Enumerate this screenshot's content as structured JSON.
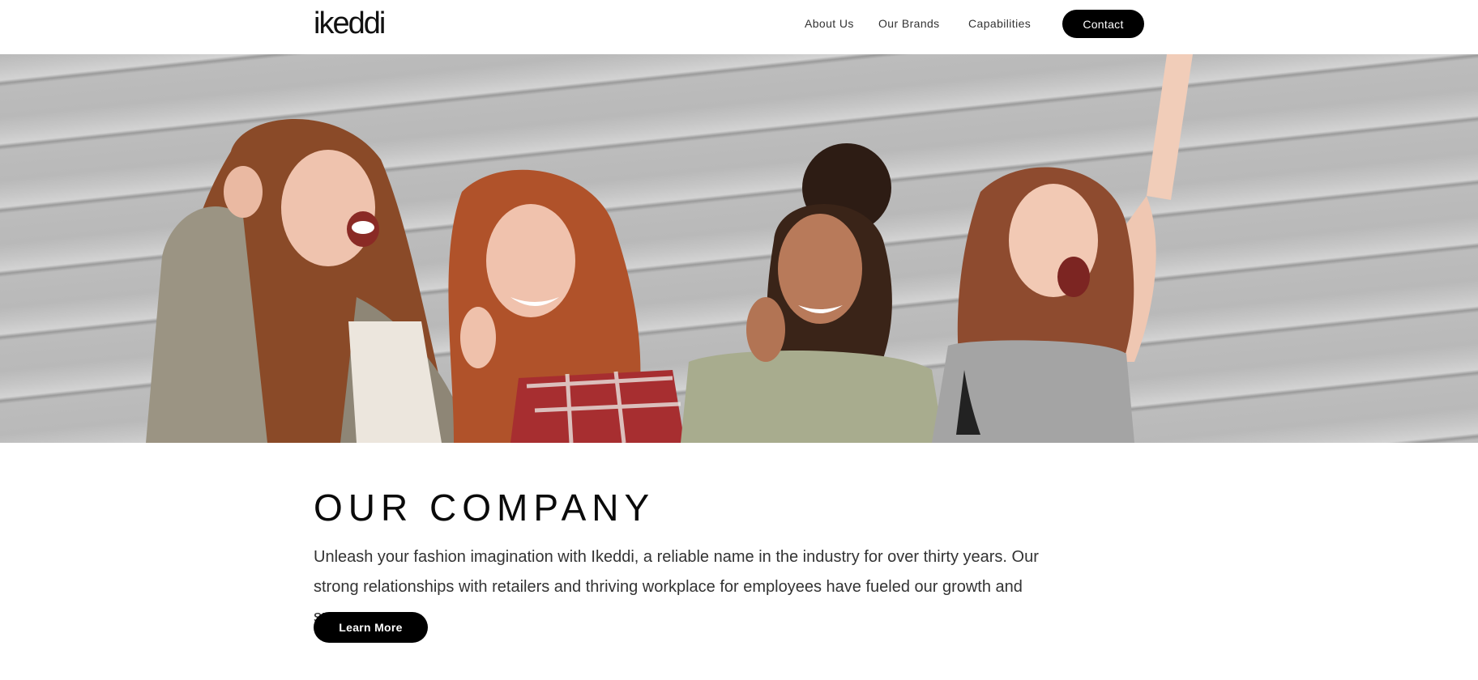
{
  "header": {
    "logo_text": "ikeddi",
    "nav": {
      "about": "About Us",
      "brands": "Our Brands",
      "capabilities": "Capabilities",
      "contact": "Contact"
    }
  },
  "hero": {
    "image_subject": "four smiling women against a grey corrugated wall"
  },
  "main": {
    "title": "OUR COMPANY",
    "description": "Unleash your fashion imagination with Ikeddi, a reliable name in the industry for over thirty years. Our strong relationships with retailers and thriving workplace for employees have fueled our growth and success.",
    "cta_label": "Learn More"
  },
  "colors": {
    "button_bg": "#000000",
    "button_text": "#ffffff",
    "page_bg": "#ffffff"
  }
}
